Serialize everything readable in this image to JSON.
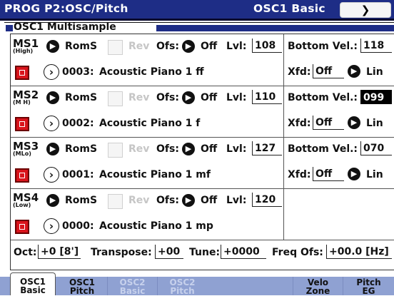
{
  "header": {
    "page_title": "PROG P2:OSC/Pitch",
    "subpage": "OSC1 Basic",
    "menu_icon": "chevron-down-icon"
  },
  "section": {
    "label": "OSC1 Multisample"
  },
  "rows": [
    {
      "ms": "MS1",
      "level_tag": "(High)",
      "rom": "RomS",
      "rev": "Rev",
      "ofs_label": "Ofs:",
      "ofs_value": "Off",
      "lvl_label": "Lvl:",
      "lvl_value": "108",
      "bottom_label": "Bottom Vel.:",
      "bottom_value": "118",
      "sample_num": "0003:",
      "sample_name": "Acoustic Piano 1 ff",
      "xfd_label": "Xfd:",
      "xfd_value": "Off",
      "curve": "Lin"
    },
    {
      "ms": "MS2",
      "level_tag": "(M H)",
      "rom": "RomS",
      "rev": "Rev",
      "ofs_label": "Ofs:",
      "ofs_value": "Off",
      "lvl_label": "Lvl:",
      "lvl_value": "110",
      "bottom_label": "Bottom Vel.:",
      "bottom_value": "099",
      "sample_num": "0002:",
      "sample_name": "Acoustic Piano 1 f",
      "xfd_label": "Xfd:",
      "xfd_value": "Off",
      "curve": "Lin"
    },
    {
      "ms": "MS3",
      "level_tag": "(MLo)",
      "rom": "RomS",
      "rev": "Rev",
      "ofs_label": "Ofs:",
      "ofs_value": "Off",
      "lvl_label": "Lvl:",
      "lvl_value": "127",
      "bottom_label": "Bottom Vel.:",
      "bottom_value": "070",
      "sample_num": "0001:",
      "sample_name": "Acoustic Piano 1 mf",
      "xfd_label": "Xfd:",
      "xfd_value": "Off",
      "curve": "Lin"
    },
    {
      "ms": "MS4",
      "level_tag": "(Low)",
      "rom": "RomS",
      "rev": "Rev",
      "ofs_label": "Ofs:",
      "ofs_value": "Off",
      "lvl_label": "Lvl:",
      "lvl_value": "120",
      "sample_num": "0000:",
      "sample_name": "Acoustic Piano 1 mp"
    }
  ],
  "bottom": {
    "oct_label": "Oct:",
    "oct_value": "+0 [8']",
    "transpose_label": "Transpose:",
    "transpose_value": "+00",
    "tune_label": "Tune:",
    "tune_value": "+0000",
    "freq_label": "Freq Ofs:",
    "freq_value": "+00.0 [Hz]"
  },
  "tabs": [
    {
      "line1": "OSC1",
      "line2": "Basic",
      "state": "active"
    },
    {
      "line1": "OSC1",
      "line2": "Pitch",
      "state": "normal"
    },
    {
      "line1": "OSC2",
      "line2": "Basic",
      "state": "disabled"
    },
    {
      "line1": "OSC2",
      "line2": "Pitch",
      "state": "disabled"
    },
    {
      "line1": "Velo",
      "line2": "Zone",
      "state": "normal"
    },
    {
      "line1": "Pitch",
      "line2": "EG",
      "state": "normal"
    }
  ]
}
